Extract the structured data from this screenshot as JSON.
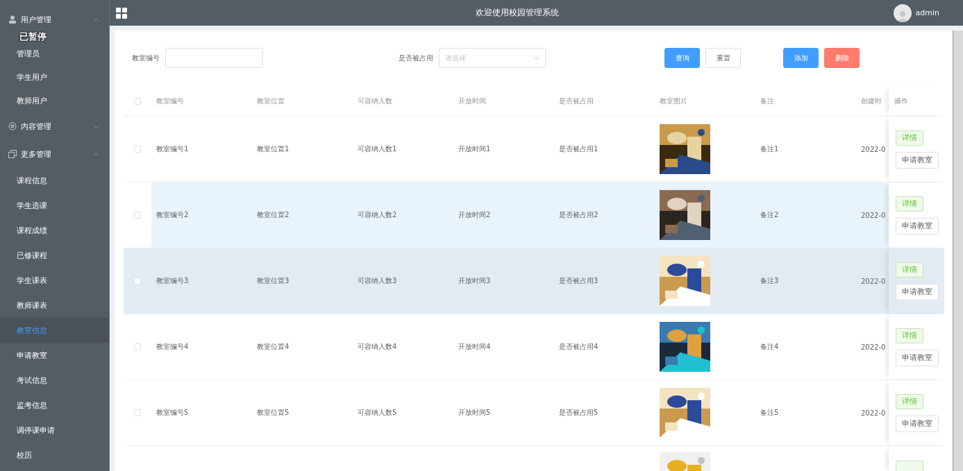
{
  "header": {
    "title": "欢迎使用校园管理系统",
    "user": "admin"
  },
  "overlay_label": "已暂停",
  "sidebar": {
    "groups": [
      {
        "label": "用户管理",
        "expanded": true,
        "children": [
          {
            "label": "管理员",
            "selected": false
          },
          {
            "label": "学生用户",
            "selected": false
          },
          {
            "label": "教师用户",
            "selected": false
          }
        ]
      },
      {
        "label": "内容管理",
        "expanded": false
      },
      {
        "label": "更多管理",
        "expanded": true,
        "children": [
          {
            "label": "课程信息",
            "selected": false
          },
          {
            "label": "学生选课",
            "selected": false
          },
          {
            "label": "课程成绩",
            "selected": false
          },
          {
            "label": "已修课程",
            "selected": false
          },
          {
            "label": "学生课表",
            "selected": false
          },
          {
            "label": "教师课表",
            "selected": false
          },
          {
            "label": "教室信息",
            "selected": true
          },
          {
            "label": "申请教室",
            "selected": false
          },
          {
            "label": "考试信息",
            "selected": false
          },
          {
            "label": "监考信息",
            "selected": false
          },
          {
            "label": "调停课申请",
            "selected": false
          },
          {
            "label": "校历",
            "selected": false
          }
        ]
      }
    ]
  },
  "search": {
    "fields": [
      {
        "kind": "input",
        "label": "教室编号"
      },
      {
        "kind": "select",
        "label": "是否被占用",
        "placeholder": "请选择"
      }
    ],
    "buttons": [
      {
        "label": "查询",
        "kind": "primary"
      },
      {
        "label": "重置",
        "kind": "plain"
      },
      {
        "label": "添加",
        "kind": "primary"
      },
      {
        "label": "删除",
        "kind": "danger"
      }
    ]
  },
  "table": {
    "all_checked": false,
    "columns": [
      "教室编号",
      "教室位置",
      "可容纳人数",
      "开放时间",
      "是否被占用",
      "教室图片",
      "备注",
      "创建时",
      "操作"
    ],
    "rows": [
      {
        "checked": false,
        "hovered": false,
        "striped": false,
        "cells": [
          "教室编号1",
          "教室位置1",
          "可容纳人数1",
          "开放时间1",
          "是否被占用1",
          "",
          "备注1",
          "2022-0"
        ],
        "actions": [
          "详情",
          "申请教室"
        ]
      },
      {
        "checked": false,
        "hovered": true,
        "striped": false,
        "cells": [
          "教室编号2",
          "教室位置2",
          "可容纳人数2",
          "开放时间2",
          "是否被占用2",
          "",
          "备注2",
          "2022-0"
        ],
        "actions": [
          "详情",
          "申请教室"
        ]
      },
      {
        "checked": false,
        "hovered": false,
        "striped": true,
        "cells": [
          "教室编号3",
          "教室位置3",
          "可容纳人数3",
          "开放时间3",
          "是否被占用3",
          "",
          "备注3",
          "2022-0"
        ],
        "actions": [
          "详情",
          "申请教室"
        ]
      },
      {
        "checked": false,
        "hovered": false,
        "striped": false,
        "cells": [
          "教室编号4",
          "教室位置4",
          "可容纳人数4",
          "开放时间4",
          "是否被占用4",
          "",
          "备注4",
          "2022-0"
        ],
        "actions": [
          "详情",
          "申请教室"
        ]
      },
      {
        "checked": false,
        "hovered": false,
        "striped": false,
        "cells": [
          "教室编号5",
          "教室位置5",
          "可容纳人数5",
          "开放时间5",
          "是否被占用5",
          "",
          "备注5",
          "2022-0"
        ],
        "actions": [
          "详情",
          "申请教室"
        ]
      },
      {
        "cells": []
      }
    ]
  }
}
